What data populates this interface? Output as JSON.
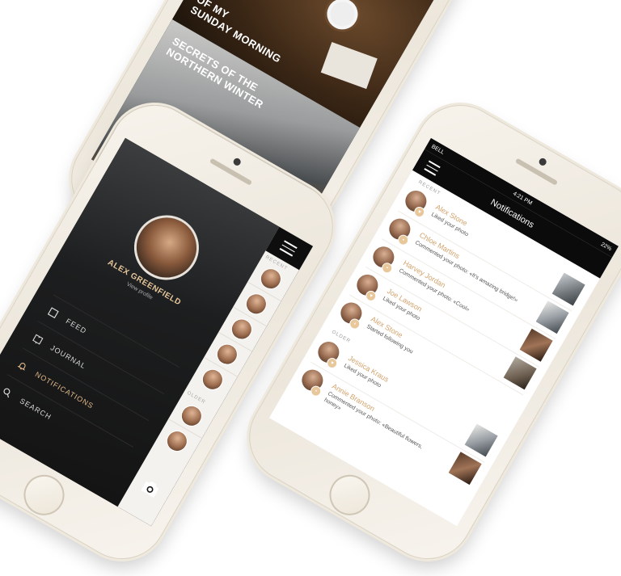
{
  "article_app": {
    "articles": [
      {
        "title": "OF MY\nSUNDAY MORNING"
      },
      {
        "title": "SECRETS OF THE\nNORTHERN WINTER"
      }
    ]
  },
  "menu_app": {
    "profile": {
      "name": "ALEX GREENFIELD",
      "sub": "View profile"
    },
    "items": [
      {
        "label": "FEED",
        "icon": "feed-icon"
      },
      {
        "label": "JOURNAL",
        "icon": "journal-icon"
      },
      {
        "label": "NOTIFICATIONS",
        "icon": "bell-icon",
        "active": true
      },
      {
        "label": "SEARCH",
        "icon": "search-icon"
      }
    ],
    "side_labels": {
      "recent": "RECENT",
      "older": "OLDER"
    },
    "accent_color": "#e0b88a"
  },
  "notif_app": {
    "status": {
      "carrier": "BELL",
      "time": "4:21 PM",
      "battery": "22%"
    },
    "title": "Notifications",
    "sections": {
      "recent": "RECENT",
      "older": "OLDER"
    },
    "recent": [
      {
        "name": "Alex Stone",
        "text": "Liked your photo",
        "thumb": true
      },
      {
        "name": "Chloe Martins",
        "text": "Commented your photo: «It's amazing bridge!»",
        "thumb": true
      },
      {
        "name": "Harvey Jordan",
        "text": "Commented your photo: «Cool»",
        "thumb": true
      },
      {
        "name": "Joe Lawson",
        "text": "Liked your photo",
        "thumb": true
      },
      {
        "name": "Alex Stone",
        "text": "Started following you",
        "thumb": false
      }
    ],
    "older": [
      {
        "name": "Jessica Kraus",
        "text": "Liked your photo",
        "thumb": true
      },
      {
        "name": "Annie Branson",
        "text": "Commented your photo: «Beautiful flowers, honey»",
        "thumb": true
      }
    ]
  }
}
